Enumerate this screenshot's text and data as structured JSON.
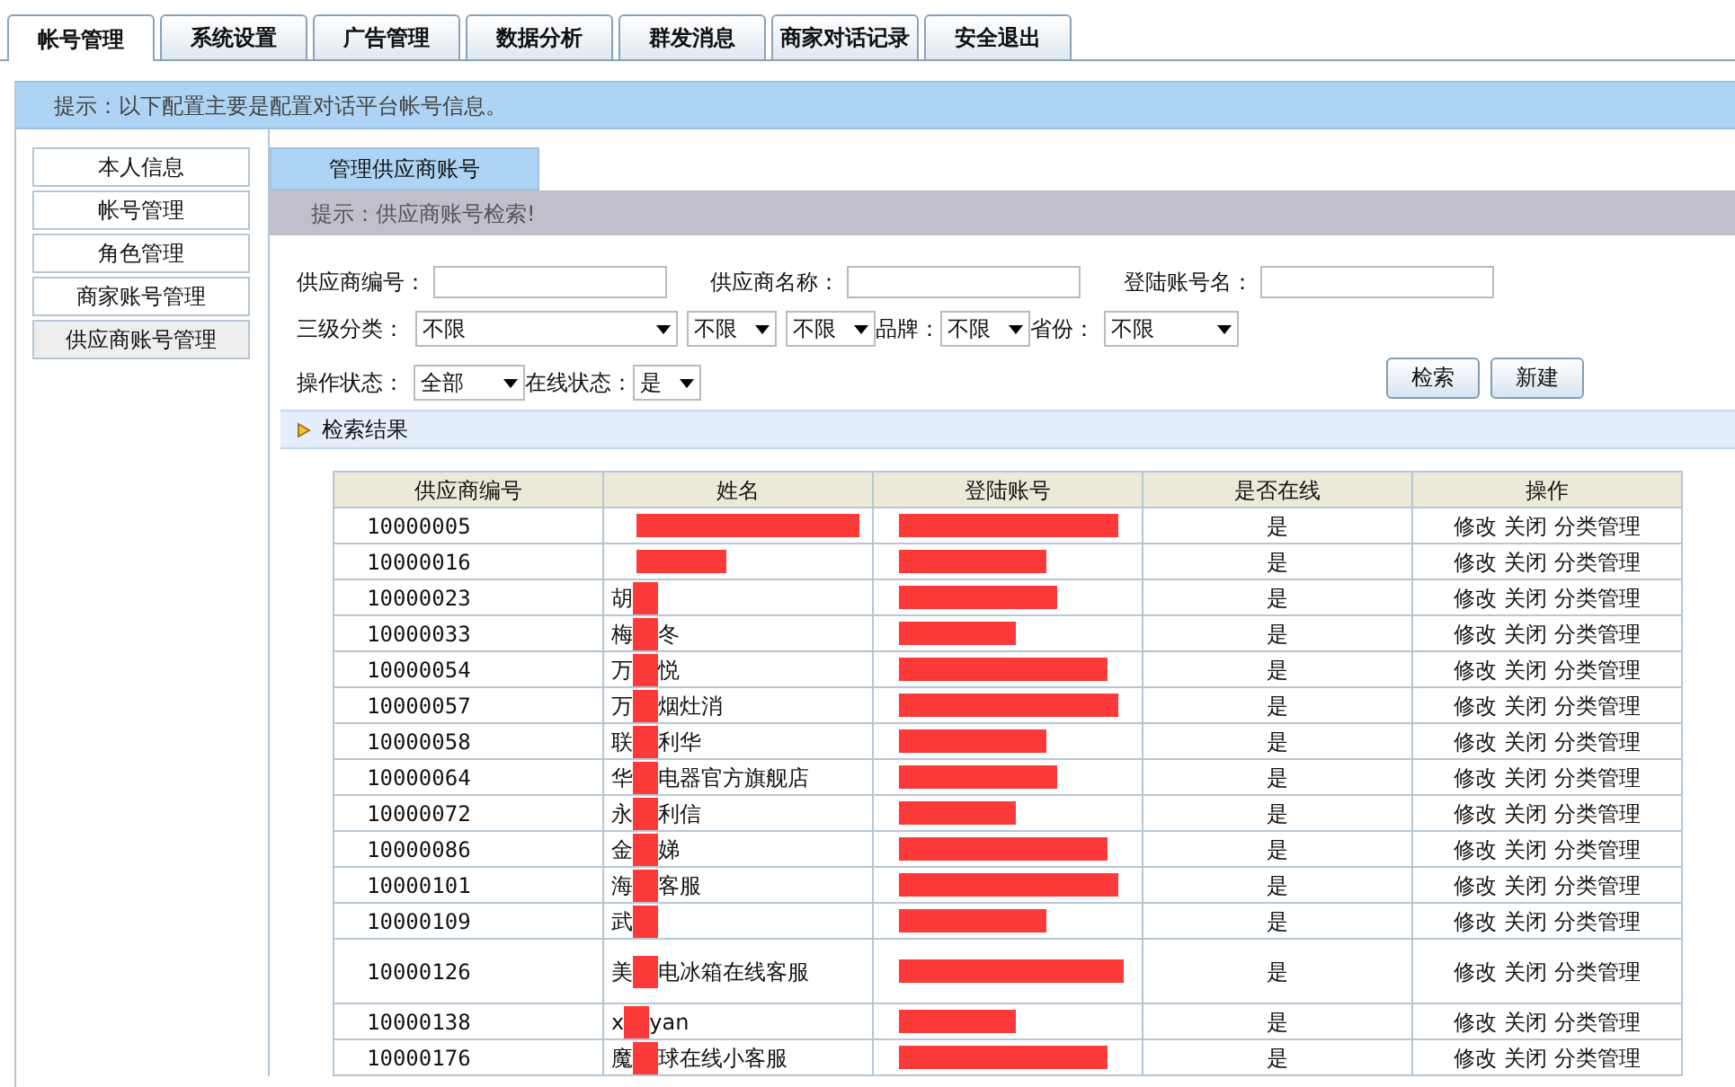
{
  "tabs": [
    {
      "label": "帐号管理",
      "selected": true
    },
    {
      "label": "系统设置",
      "selected": false
    },
    {
      "label": "广告管理",
      "selected": false
    },
    {
      "label": "数据分析",
      "selected": false
    },
    {
      "label": "群发消息",
      "selected": false
    },
    {
      "label": "商家对话记录",
      "selected": false
    },
    {
      "label": "安全退出",
      "selected": false
    }
  ],
  "hint": "提示：以下配置主要是配置对话平台帐号信息。",
  "sidebar": {
    "items": [
      {
        "label": "本人信息",
        "selected": false
      },
      {
        "label": "帐号管理",
        "selected": false
      },
      {
        "label": "角色管理",
        "selected": false
      },
      {
        "label": "商家账号管理",
        "selected": false
      },
      {
        "label": "供应商账号管理",
        "selected": true
      }
    ]
  },
  "panel_tab": "管理供应商账号",
  "panel_hint": "提示：供应商账号检索!",
  "form": {
    "supplier_id_label": "供应商编号：",
    "supplier_name_label": "供应商名称：",
    "login_name_label": "登陆账号名：",
    "category_label": "三级分类：",
    "category_1": "不限",
    "category_2": "不限",
    "category_3": "不限",
    "brand_label": "品牌：",
    "brand": "不限",
    "province_label": "省份：",
    "province": "不限",
    "op_status_label": "操作状态：",
    "op_status": "全部",
    "online_label": "在线状态：",
    "online": "是",
    "search_button": "检索",
    "new_button": "新建"
  },
  "results": {
    "title": "检索结果",
    "columns": [
      "供应商编号",
      "姓名",
      "登陆账号",
      "是否在线",
      "操作"
    ],
    "rows": [
      {
        "id": "10000005",
        "name": [],
        "online": "是",
        "actions": [
          "修改",
          "关闭",
          "分类管理"
        ]
      },
      {
        "id": "10000016",
        "name": [],
        "online": "是",
        "actions": [
          "修改",
          "关闭",
          "分类管理"
        ]
      },
      {
        "id": "10000023",
        "name": [
          "胡"
        ],
        "online": "是",
        "actions": [
          "修改",
          "关闭",
          "分类管理"
        ]
      },
      {
        "id": "10000033",
        "name": [
          "梅",
          "冬"
        ],
        "online": "是",
        "actions": [
          "修改",
          "关闭",
          "分类管理"
        ]
      },
      {
        "id": "10000054",
        "name": [
          "万",
          "悦"
        ],
        "online": "是",
        "actions": [
          "修改",
          "关闭",
          "分类管理"
        ]
      },
      {
        "id": "10000057",
        "name": [
          "万",
          "烟灶消"
        ],
        "online": "是",
        "actions": [
          "修改",
          "关闭",
          "分类管理"
        ]
      },
      {
        "id": "10000058",
        "name": [
          "联",
          "利华"
        ],
        "online": "是",
        "actions": [
          "修改",
          "关闭",
          "分类管理"
        ]
      },
      {
        "id": "10000064",
        "name": [
          "华",
          "电器官方旗舰店"
        ],
        "online": "是",
        "actions": [
          "修改",
          "关闭",
          "分类管理"
        ]
      },
      {
        "id": "10000072",
        "name": [
          "永",
          "利信"
        ],
        "online": "是",
        "actions": [
          "修改",
          "关闭",
          "分类管理"
        ]
      },
      {
        "id": "10000086",
        "name": [
          "金",
          "娣"
        ],
        "online": "是",
        "actions": [
          "修改",
          "关闭",
          "分类管理"
        ]
      },
      {
        "id": "10000101",
        "name": [
          "海",
          "客服"
        ],
        "online": "是",
        "actions": [
          "修改",
          "关闭",
          "分类管理"
        ]
      },
      {
        "id": "10000109",
        "name": [
          "武"
        ],
        "online": "是",
        "actions": [
          "修改",
          "关闭",
          "分类管理"
        ]
      },
      {
        "id": "10000126",
        "name": [
          "美",
          "电冰箱在线客服"
        ],
        "online": "是",
        "actions": [
          "修改",
          "关闭",
          "分类管理"
        ],
        "tall": true
      },
      {
        "id": "10000138",
        "name": [
          "x",
          "yan"
        ],
        "online": "是",
        "actions": [
          "修改",
          "关闭",
          "分类管理"
        ]
      },
      {
        "id": "10000176",
        "name": [
          "魔",
          "球在线小客服"
        ],
        "online": "是",
        "actions": [
          "修改",
          "关闭",
          "分类管理"
        ]
      }
    ]
  }
}
